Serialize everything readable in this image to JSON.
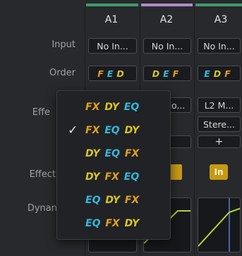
{
  "channels": [
    {
      "name": "A1",
      "strip_color": "#3f9a6a"
    },
    {
      "name": "A2",
      "strip_color": "#b489c4"
    },
    {
      "name": "A3",
      "strip_color": "#3f9a6a"
    }
  ],
  "rows": {
    "input_label": "Input",
    "order_label": "Order",
    "effects_label": "Effe",
    "effects_in_label": "Effect",
    "dynamics_label": "Dynan"
  },
  "inputs": [
    "No In...",
    "No In...",
    "No In..."
  ],
  "order": [
    {
      "tags": [
        {
          "t": "F",
          "c": "orange"
        },
        {
          "t": "E",
          "c": "cyan"
        },
        {
          "t": "D",
          "c": "yellow"
        }
      ]
    },
    {
      "tags": [
        {
          "t": "D",
          "c": "yellow"
        },
        {
          "t": "E",
          "c": "cyan"
        },
        {
          "t": "F",
          "c": "orange"
        }
      ]
    },
    {
      "tags": [
        {
          "t": "E",
          "c": "cyan"
        },
        {
          "t": "D",
          "c": "yellow"
        },
        {
          "t": "F",
          "c": "orange"
        }
      ]
    }
  ],
  "effects": {
    "a2_partial": "o...",
    "a3_slot1": "L2 M...",
    "a3_slot2": "Stere...",
    "add_label": "+"
  },
  "effects_in_button": "In",
  "popup": {
    "selected_index": 1,
    "check_mark": "✓",
    "options": [
      [
        {
          "t": "FX",
          "c": "orange"
        },
        {
          "t": "DY",
          "c": "yellow"
        },
        {
          "t": "EQ",
          "c": "cyan"
        }
      ],
      [
        {
          "t": "FX",
          "c": "orange"
        },
        {
          "t": "EQ",
          "c": "cyan"
        },
        {
          "t": "DY",
          "c": "yellow"
        }
      ],
      [
        {
          "t": "DY",
          "c": "yellow"
        },
        {
          "t": "EQ",
          "c": "cyan"
        },
        {
          "t": "FX",
          "c": "orange"
        }
      ],
      [
        {
          "t": "DY",
          "c": "yellow"
        },
        {
          "t": "FX",
          "c": "orange"
        },
        {
          "t": "EQ",
          "c": "cyan"
        }
      ],
      [
        {
          "t": "EQ",
          "c": "cyan"
        },
        {
          "t": "DY",
          "c": "yellow"
        },
        {
          "t": "FX",
          "c": "orange"
        }
      ],
      [
        {
          "t": "EQ",
          "c": "cyan"
        },
        {
          "t": "FX",
          "c": "orange"
        },
        {
          "t": "DY",
          "c": "yellow"
        }
      ]
    ]
  },
  "colors": {
    "orange": "#e0a023",
    "cyan": "#37b8d8",
    "yellow": "#d7c42a",
    "accent_button": "#c79a14",
    "curve_green": "#b5d334",
    "curve_blue": "#5a7fd8"
  }
}
